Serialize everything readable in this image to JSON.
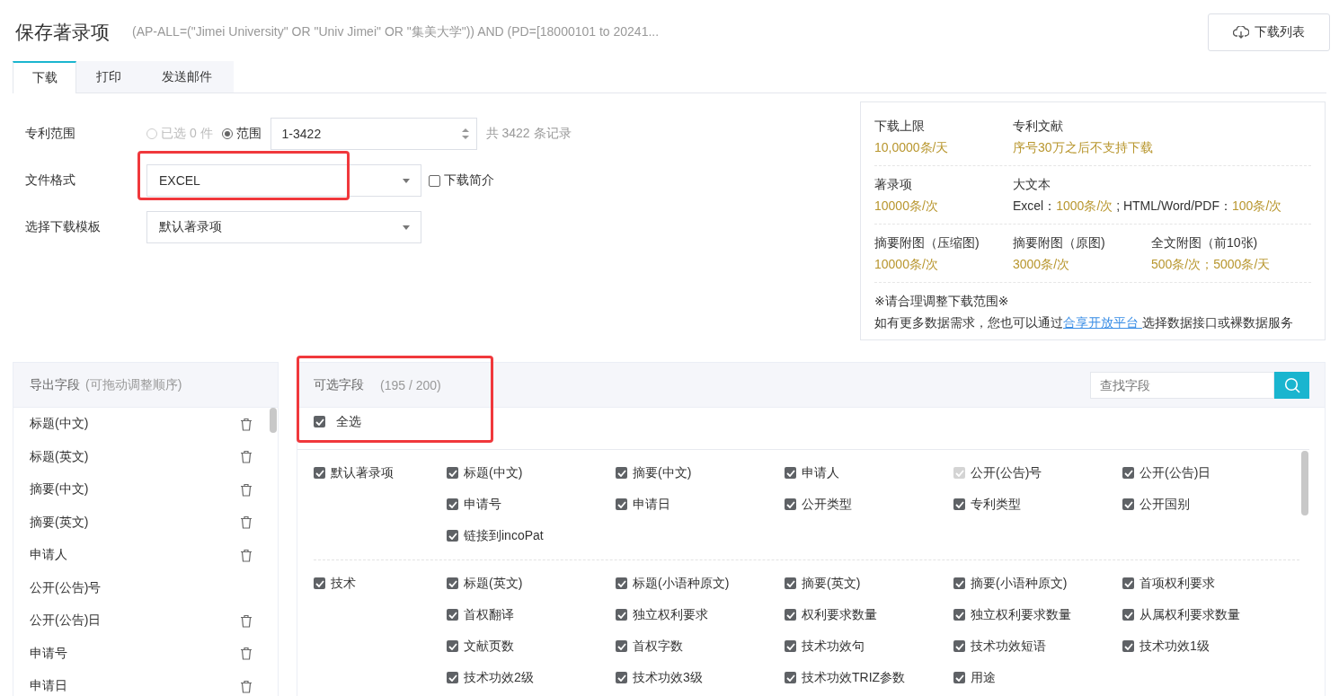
{
  "title": "保存著录项",
  "query": "(AP-ALL=(\"Jimei University\" OR \"Univ Jimei\" OR \"集美大学\")) AND (PD=[18000101 to 20241...",
  "download_list_button": "下载列表",
  "tabs": [
    {
      "label": "下载",
      "selected": true
    },
    {
      "label": "打印",
      "selected": false
    },
    {
      "label": "发送邮件",
      "selected": false
    }
  ],
  "form": {
    "scope": {
      "label": "专利范围",
      "options": [
        {
          "label": "已选 0 件",
          "selected": false,
          "disabled": true
        },
        {
          "label": "范围",
          "selected": true,
          "disabled": false
        }
      ],
      "range_value": "1-3422",
      "total": "共 3422 条记录"
    },
    "format": {
      "label": "文件格式",
      "value": "EXCEL",
      "summary_checkbox": {
        "label": "下载简介",
        "checked": false
      }
    },
    "template": {
      "label": "选择下载模板",
      "value": "默认著录项"
    }
  },
  "limits": {
    "rows": [
      [
        {
          "label": "下载上限",
          "value": "10,0000条/天"
        },
        {
          "label": "专利文献",
          "value": "序号30万之后不支持下载"
        }
      ],
      [
        {
          "label": "著录项",
          "value": "10000条/次"
        },
        {
          "label": "大文本",
          "parts": [
            {
              "text": "Excel：",
              "kind": "text"
            },
            {
              "text": "1000条/次",
              "kind": "value"
            },
            {
              "text": " ; HTML/Word/PDF：",
              "kind": "text"
            },
            {
              "text": "100条/次",
              "kind": "value"
            }
          ]
        }
      ],
      [
        {
          "label": "摘要附图（压缩图)",
          "value": "10000条/次"
        },
        {
          "label": "摘要附图（原图)",
          "value": "3000条/次"
        },
        {
          "label": "全文附图（前10张)",
          "value": "500条/次；5000条/天"
        }
      ]
    ],
    "note": "※请合理调整下载范围※",
    "footer": {
      "before": "如有更多数据需求，您也可以通过",
      "link": "合享开放平台 ",
      "after": "选择数据接口或裸数据服务"
    }
  },
  "export_fields": {
    "title": "导出字段",
    "hint": "(可拖动调整顺序)",
    "items": [
      {
        "label": "标题(中文)",
        "removable": true
      },
      {
        "label": "标题(英文)",
        "removable": true
      },
      {
        "label": "摘要(中文)",
        "removable": true
      },
      {
        "label": "摘要(英文)",
        "removable": true
      },
      {
        "label": "申请人",
        "removable": true
      },
      {
        "label": "公开(公告)号",
        "removable": false
      },
      {
        "label": "公开(公告)日",
        "removable": true
      },
      {
        "label": "申请号",
        "removable": true
      },
      {
        "label": "申请日",
        "removable": true
      }
    ]
  },
  "selectable_fields": {
    "title": "可选字段",
    "count": "(195 / 200)",
    "search_placeholder": "查找字段",
    "select_all": {
      "label": "全选",
      "checked": true
    },
    "groups": [
      {
        "label": "默认著录项",
        "checked": true,
        "fields": [
          {
            "label": "标题(中文)",
            "checked": true,
            "disabled": false
          },
          {
            "label": "摘要(中文)",
            "checked": true,
            "disabled": false
          },
          {
            "label": "申请人",
            "checked": true,
            "disabled": false
          },
          {
            "label": "公开(公告)号",
            "checked": true,
            "disabled": true
          },
          {
            "label": "公开(公告)日",
            "checked": true,
            "disabled": false
          },
          {
            "label": "申请号",
            "checked": true,
            "disabled": false
          },
          {
            "label": "申请日",
            "checked": true,
            "disabled": false
          },
          {
            "label": "公开类型",
            "checked": true,
            "disabled": false
          },
          {
            "label": "专利类型",
            "checked": true,
            "disabled": false
          },
          {
            "label": "公开国别",
            "checked": true,
            "disabled": false
          },
          {
            "label": "链接到incoPat",
            "checked": true,
            "disabled": false
          }
        ]
      },
      {
        "label": "技术",
        "checked": true,
        "fields": [
          {
            "label": "标题(英文)",
            "checked": true,
            "disabled": false
          },
          {
            "label": "标题(小语种原文)",
            "checked": true,
            "disabled": false
          },
          {
            "label": "摘要(英文)",
            "checked": true,
            "disabled": false
          },
          {
            "label": "摘要(小语种原文)",
            "checked": true,
            "disabled": false
          },
          {
            "label": "首项权利要求",
            "checked": true,
            "disabled": false
          },
          {
            "label": "首权翻译",
            "checked": true,
            "disabled": false
          },
          {
            "label": "独立权利要求",
            "checked": true,
            "disabled": false
          },
          {
            "label": "权利要求数量",
            "checked": true,
            "disabled": false
          },
          {
            "label": "独立权利要求数量",
            "checked": true,
            "disabled": false
          },
          {
            "label": "从属权利要求数量",
            "checked": true,
            "disabled": false
          },
          {
            "label": "文献页数",
            "checked": true,
            "disabled": false
          },
          {
            "label": "首权字数",
            "checked": true,
            "disabled": false
          },
          {
            "label": "技术功效句",
            "checked": true,
            "disabled": false
          },
          {
            "label": "技术功效短语",
            "checked": true,
            "disabled": false
          },
          {
            "label": "技术功效1级",
            "checked": true,
            "disabled": false
          },
          {
            "label": "技术功效2级",
            "checked": true,
            "disabled": false
          },
          {
            "label": "技术功效3级",
            "checked": true,
            "disabled": false
          },
          {
            "label": "技术功效TRIZ参数",
            "checked": true,
            "disabled": false
          },
          {
            "label": "用途",
            "checked": true,
            "disabled": false
          }
        ]
      }
    ]
  }
}
